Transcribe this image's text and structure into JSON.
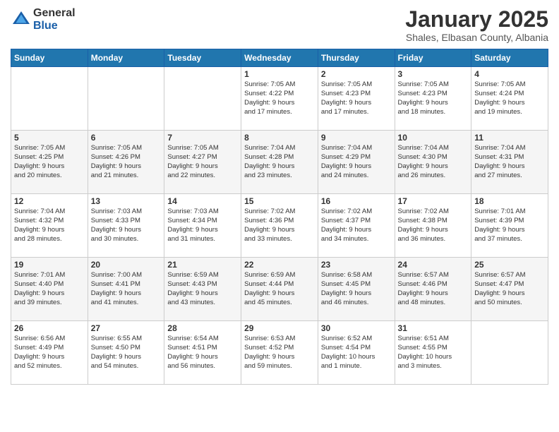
{
  "logo": {
    "general": "General",
    "blue": "Blue"
  },
  "header": {
    "month": "January 2025",
    "location": "Shales, Elbasan County, Albania"
  },
  "weekdays": [
    "Sunday",
    "Monday",
    "Tuesday",
    "Wednesday",
    "Thursday",
    "Friday",
    "Saturday"
  ],
  "weeks": [
    [
      {
        "day": "",
        "info": ""
      },
      {
        "day": "",
        "info": ""
      },
      {
        "day": "",
        "info": ""
      },
      {
        "day": "1",
        "info": "Sunrise: 7:05 AM\nSunset: 4:22 PM\nDaylight: 9 hours\nand 17 minutes."
      },
      {
        "day": "2",
        "info": "Sunrise: 7:05 AM\nSunset: 4:23 PM\nDaylight: 9 hours\nand 17 minutes."
      },
      {
        "day": "3",
        "info": "Sunrise: 7:05 AM\nSunset: 4:23 PM\nDaylight: 9 hours\nand 18 minutes."
      },
      {
        "day": "4",
        "info": "Sunrise: 7:05 AM\nSunset: 4:24 PM\nDaylight: 9 hours\nand 19 minutes."
      }
    ],
    [
      {
        "day": "5",
        "info": "Sunrise: 7:05 AM\nSunset: 4:25 PM\nDaylight: 9 hours\nand 20 minutes."
      },
      {
        "day": "6",
        "info": "Sunrise: 7:05 AM\nSunset: 4:26 PM\nDaylight: 9 hours\nand 21 minutes."
      },
      {
        "day": "7",
        "info": "Sunrise: 7:05 AM\nSunset: 4:27 PM\nDaylight: 9 hours\nand 22 minutes."
      },
      {
        "day": "8",
        "info": "Sunrise: 7:04 AM\nSunset: 4:28 PM\nDaylight: 9 hours\nand 23 minutes."
      },
      {
        "day": "9",
        "info": "Sunrise: 7:04 AM\nSunset: 4:29 PM\nDaylight: 9 hours\nand 24 minutes."
      },
      {
        "day": "10",
        "info": "Sunrise: 7:04 AM\nSunset: 4:30 PM\nDaylight: 9 hours\nand 26 minutes."
      },
      {
        "day": "11",
        "info": "Sunrise: 7:04 AM\nSunset: 4:31 PM\nDaylight: 9 hours\nand 27 minutes."
      }
    ],
    [
      {
        "day": "12",
        "info": "Sunrise: 7:04 AM\nSunset: 4:32 PM\nDaylight: 9 hours\nand 28 minutes."
      },
      {
        "day": "13",
        "info": "Sunrise: 7:03 AM\nSunset: 4:33 PM\nDaylight: 9 hours\nand 30 minutes."
      },
      {
        "day": "14",
        "info": "Sunrise: 7:03 AM\nSunset: 4:34 PM\nDaylight: 9 hours\nand 31 minutes."
      },
      {
        "day": "15",
        "info": "Sunrise: 7:02 AM\nSunset: 4:36 PM\nDaylight: 9 hours\nand 33 minutes."
      },
      {
        "day": "16",
        "info": "Sunrise: 7:02 AM\nSunset: 4:37 PM\nDaylight: 9 hours\nand 34 minutes."
      },
      {
        "day": "17",
        "info": "Sunrise: 7:02 AM\nSunset: 4:38 PM\nDaylight: 9 hours\nand 36 minutes."
      },
      {
        "day": "18",
        "info": "Sunrise: 7:01 AM\nSunset: 4:39 PM\nDaylight: 9 hours\nand 37 minutes."
      }
    ],
    [
      {
        "day": "19",
        "info": "Sunrise: 7:01 AM\nSunset: 4:40 PM\nDaylight: 9 hours\nand 39 minutes."
      },
      {
        "day": "20",
        "info": "Sunrise: 7:00 AM\nSunset: 4:41 PM\nDaylight: 9 hours\nand 41 minutes."
      },
      {
        "day": "21",
        "info": "Sunrise: 6:59 AM\nSunset: 4:43 PM\nDaylight: 9 hours\nand 43 minutes."
      },
      {
        "day": "22",
        "info": "Sunrise: 6:59 AM\nSunset: 4:44 PM\nDaylight: 9 hours\nand 45 minutes."
      },
      {
        "day": "23",
        "info": "Sunrise: 6:58 AM\nSunset: 4:45 PM\nDaylight: 9 hours\nand 46 minutes."
      },
      {
        "day": "24",
        "info": "Sunrise: 6:57 AM\nSunset: 4:46 PM\nDaylight: 9 hours\nand 48 minutes."
      },
      {
        "day": "25",
        "info": "Sunrise: 6:57 AM\nSunset: 4:47 PM\nDaylight: 9 hours\nand 50 minutes."
      }
    ],
    [
      {
        "day": "26",
        "info": "Sunrise: 6:56 AM\nSunset: 4:49 PM\nDaylight: 9 hours\nand 52 minutes."
      },
      {
        "day": "27",
        "info": "Sunrise: 6:55 AM\nSunset: 4:50 PM\nDaylight: 9 hours\nand 54 minutes."
      },
      {
        "day": "28",
        "info": "Sunrise: 6:54 AM\nSunset: 4:51 PM\nDaylight: 9 hours\nand 56 minutes."
      },
      {
        "day": "29",
        "info": "Sunrise: 6:53 AM\nSunset: 4:52 PM\nDaylight: 9 hours\nand 59 minutes."
      },
      {
        "day": "30",
        "info": "Sunrise: 6:52 AM\nSunset: 4:54 PM\nDaylight: 10 hours\nand 1 minute."
      },
      {
        "day": "31",
        "info": "Sunrise: 6:51 AM\nSunset: 4:55 PM\nDaylight: 10 hours\nand 3 minutes."
      },
      {
        "day": "",
        "info": ""
      }
    ]
  ]
}
